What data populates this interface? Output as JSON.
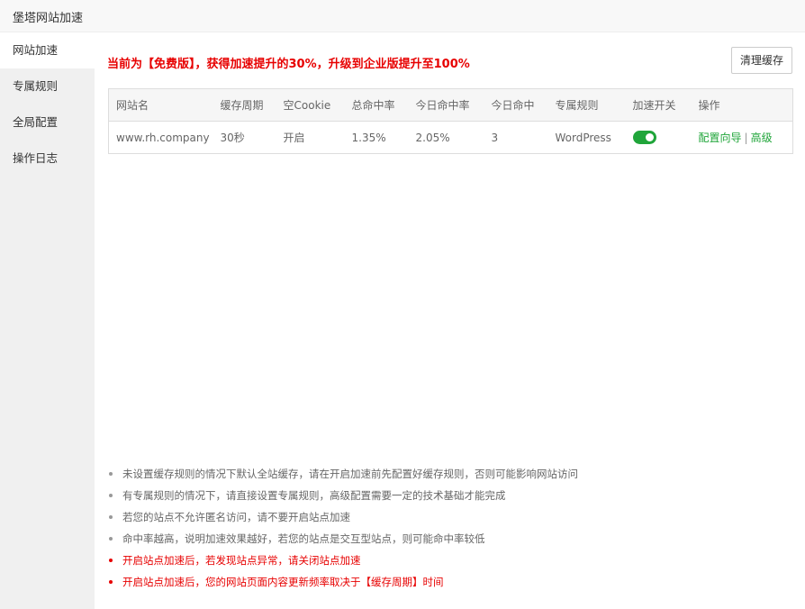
{
  "window": {
    "title": "堡塔网站加速"
  },
  "sidebar": {
    "items": [
      {
        "label": "网站加速",
        "active": true
      },
      {
        "label": "专属规则",
        "active": false
      },
      {
        "label": "全局配置",
        "active": false
      },
      {
        "label": "操作日志",
        "active": false
      }
    ]
  },
  "main": {
    "notice": "当前为【免费版】，获得加速提升的30%，升级到企业版提升至100%",
    "clear_cache_button": "清理缓存",
    "table": {
      "headers": [
        "网站名",
        "缓存周期",
        "空Cookie",
        "总命中率",
        "今日命中率",
        "今日命中",
        "专属规则",
        "加速开关",
        "操作"
      ],
      "rows": [
        {
          "site": "www.rh.company",
          "cache_period": "30秒",
          "empty_cookie": "开启",
          "total_hit_rate": "1.35%",
          "today_hit_rate": "2.05%",
          "today_hits": "3",
          "rule": "WordPress",
          "switch_on": true,
          "action_wizard": "配置向导",
          "action_separator": "|",
          "action_advanced": "高级"
        }
      ]
    },
    "tips": [
      {
        "text": "未设置缓存规则的情况下默认全站缓存，请在开启加速前先配置好缓存规则，否则可能影响网站访问",
        "highlight": false
      },
      {
        "text": "有专属规则的情况下，请直接设置专属规则，高级配置需要一定的技术基础才能完成",
        "highlight": false
      },
      {
        "text": "若您的站点不允许匿名访问，请不要开启站点加速",
        "highlight": false
      },
      {
        "text": "命中率越高，说明加速效果越好，若您的站点是交互型站点，则可能命中率较低",
        "highlight": false
      },
      {
        "text": "开启站点加速后，若发现站点异常，请关闭站点加速",
        "highlight": true
      },
      {
        "text": "开启站点加速后，您的网站页面内容更新频率取决于【缓存周期】时间",
        "highlight": true
      }
    ]
  },
  "colors": {
    "accent_green": "#20a53a",
    "warning_red": "#e70000",
    "sidebar_bg": "#f0f0f0"
  }
}
